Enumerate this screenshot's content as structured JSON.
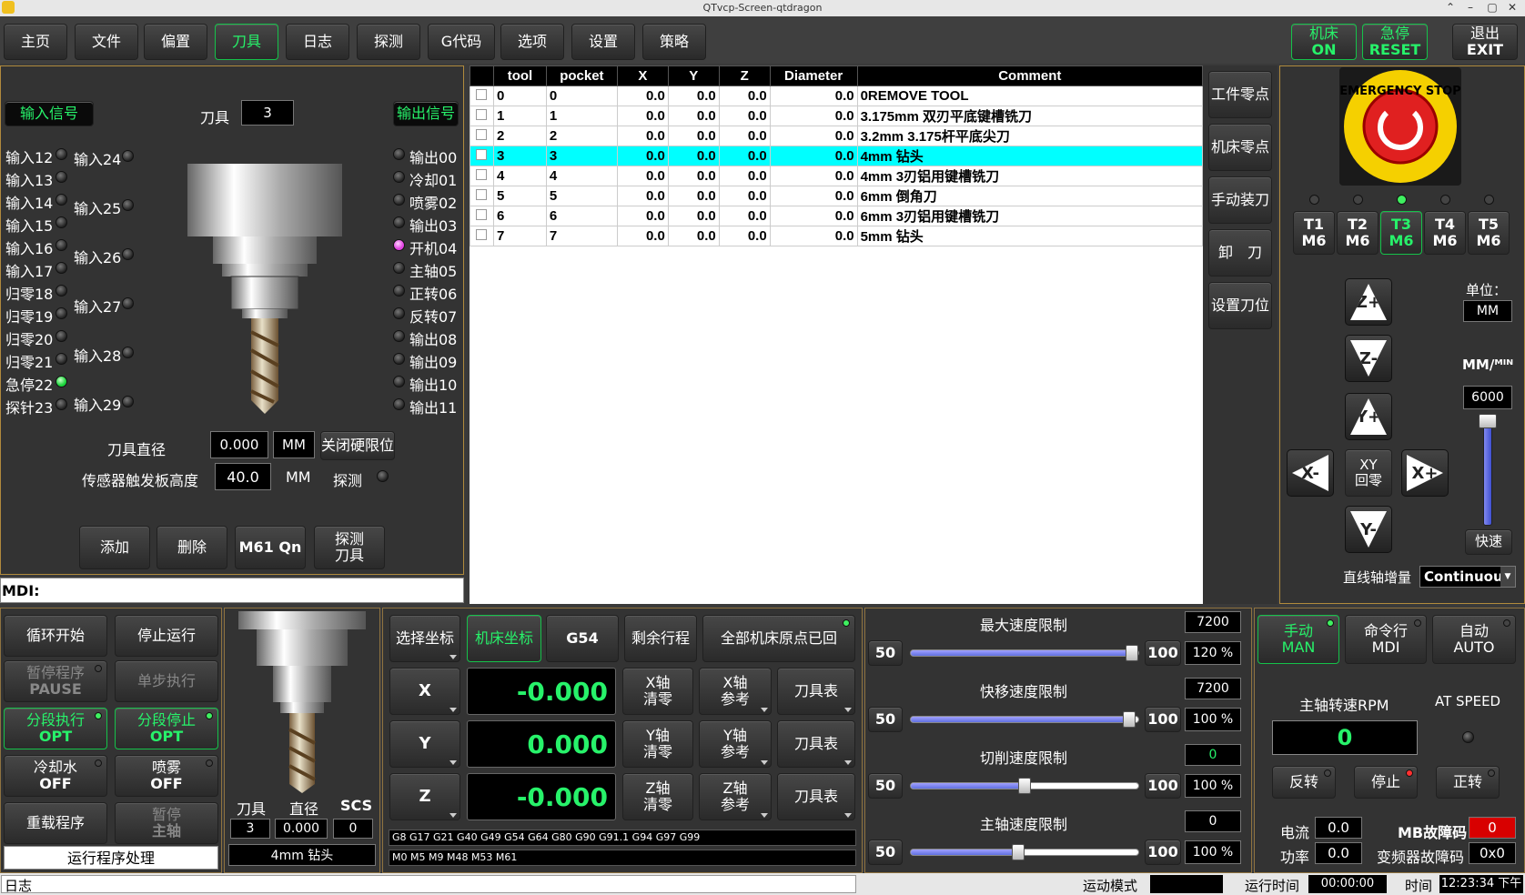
{
  "window": {
    "title": "QTvcp-Screen-qtdragon",
    "min": "–",
    "max": "▢",
    "close": "✕",
    "up": "⌃"
  },
  "tabs": [
    "主页",
    "文件",
    "偏置",
    "刀具",
    "日志",
    "探测",
    "G代码",
    "选项",
    "设置",
    "策略"
  ],
  "active_tab": "刀具",
  "top_right": {
    "machine": [
      "机床",
      "ON"
    ],
    "estop": [
      "急停",
      "RESET"
    ],
    "exit": [
      "退出",
      "EXIT"
    ]
  },
  "io": {
    "input_title": "输入信号",
    "output_title": "输出信号",
    "tool_label": "刀具",
    "tool_value": "3",
    "inputs_left": [
      "输入12",
      "输入13",
      "输入14",
      "输入15",
      "输入16",
      "输入17",
      "归零18",
      "归零19",
      "归零20",
      "归零21",
      "急停22",
      "探针23"
    ],
    "inputs_right": [
      "输入24",
      "输入25",
      "输入26",
      "输入27",
      "输入28",
      "输入29"
    ],
    "outputs": [
      "输出00",
      "冷却01",
      "喷雾02",
      "输出03",
      "开机04",
      "主轴05",
      "正转06",
      "反转07",
      "输出08",
      "输出09",
      "输出10",
      "输出11"
    ],
    "tool_diameter_label": "刀具直径",
    "tool_diameter": "0.000",
    "unit_mm": "MM",
    "close_limit": "关闭硬限位",
    "sensor_label": "传感器触发板高度",
    "sensor_value": "40.0",
    "sensor_unit": "MM",
    "probe_label": "探测",
    "buttons": [
      "添加",
      "删除",
      "M61 Qn",
      "探测\n刀具"
    ]
  },
  "mdi_label": "MDI:",
  "tool_table": {
    "headers": [
      "",
      "tool",
      "pocket",
      "X",
      "Y",
      "Z",
      "Diameter",
      "Comment"
    ],
    "rows": [
      [
        "0",
        "0",
        "0.0",
        "0.0",
        "0.0",
        "0.0",
        "0REMOVE TOOL"
      ],
      [
        "1",
        "1",
        "0.0",
        "0.0",
        "0.0",
        "0.0",
        "3.175mm 双刃平底键槽铣刀"
      ],
      [
        "2",
        "2",
        "0.0",
        "0.0",
        "0.0",
        "0.0",
        "3.2mm 3.175杆平底尖刀"
      ],
      [
        "3",
        "3",
        "0.0",
        "0.0",
        "0.0",
        "0.0",
        "4mm 钻头"
      ],
      [
        "4",
        "4",
        "0.0",
        "0.0",
        "0.0",
        "0.0",
        "4mm 3刃铝用键槽铣刀"
      ],
      [
        "5",
        "5",
        "0.0",
        "0.0",
        "0.0",
        "0.0",
        "6mm 倒角刀"
      ],
      [
        "6",
        "6",
        "0.0",
        "0.0",
        "0.0",
        "0.0",
        "6mm 3刃铝用键槽铣刀"
      ],
      [
        "7",
        "7",
        "0.0",
        "0.0",
        "0.0",
        "0.0",
        "5mm 钻头"
      ]
    ],
    "selected": 3
  },
  "side_buttons": [
    "工件零点",
    "机床零点",
    "手动装刀",
    "卸　刀",
    "设置刀位"
  ],
  "estop_text": "EMERGENCY STOP",
  "tool_changers": [
    [
      "T1",
      "M6"
    ],
    [
      "T2",
      "M6"
    ],
    [
      "T3",
      "M6"
    ],
    [
      "T4",
      "M6"
    ],
    [
      "T5",
      "M6"
    ]
  ],
  "jog": {
    "zplus": "Z+",
    "zminus": "Z-",
    "yplus": "Y+",
    "yminus": "Y-",
    "xminus": "X-",
    "xplus": "X+",
    "xy_home": [
      "XY",
      "回零"
    ],
    "unit_label": "单位：",
    "unit": "MM",
    "rate_label": "MM/ᴹᴵᴺ",
    "rate": "6000",
    "rapid": "快速",
    "increment_label": "直线轴增量",
    "increment": "Continuous"
  },
  "program": {
    "cycle_start": "循环开始",
    "stop": "停止运行",
    "pause": [
      "暂停程序",
      "PAUSE"
    ],
    "step": "单步执行",
    "opt_run": [
      "分段执行",
      "OPT"
    ],
    "opt_stop": [
      "分段停止",
      "OPT"
    ],
    "coolant": [
      "冷却水",
      "OFF"
    ],
    "mist": [
      "喷雾",
      "OFF"
    ],
    "reload": "重载程序",
    "pause_spindle": [
      "暂停",
      "主轴"
    ],
    "status": "运行程序处理"
  },
  "tool_info": {
    "tool_label": "刀具",
    "dia_label": "直径",
    "scs_label": "SCS",
    "tool": "3",
    "dia": "0.000",
    "scs": "0",
    "desc": "4mm 钻头"
  },
  "dro": {
    "select_coord": "选择坐标",
    "machine_coord": "机床坐标",
    "g54": "G54",
    "remaining": "剩余行程",
    "home_all": "全部机床原点已回",
    "axes": [
      {
        "name": "X",
        "value": "-0.000",
        "zero": [
          "X轴",
          "清零"
        ],
        "ref": [
          "X轴",
          "参考"
        ],
        "table": "刀具表"
      },
      {
        "name": "Y",
        "value": "0.000",
        "zero": [
          "Y轴",
          "清零"
        ],
        "ref": [
          "Y轴",
          "参考"
        ],
        "table": "刀具表"
      },
      {
        "name": "Z",
        "value": "-0.000",
        "zero": [
          "Z轴",
          "清零"
        ],
        "ref": [
          "Z轴",
          "参考"
        ],
        "table": "刀具表"
      }
    ],
    "gcodes": "G8 G17 G21 G40 G49 G54 G64 G80 G90 G91.1 G94 G97 G99",
    "mcodes": "M0 M5 M9 M48 M53 M61"
  },
  "limits": [
    {
      "label": "最大速度限制",
      "value": "7200",
      "min": "50",
      "max": "100",
      "pct": "120 %",
      "level": 0.97
    },
    {
      "label": "快移速度限制",
      "value": "7200",
      "min": "50",
      "max": "100",
      "pct": "100 %",
      "level": 0.96
    },
    {
      "label": "切削速度限制",
      "value": "0",
      "min": "50",
      "max": "100",
      "pct": "100 %",
      "level": 0.5
    },
    {
      "label": "主轴速度限制",
      "value": "0",
      "min": "50",
      "max": "100",
      "pct": "100 %",
      "level": 0.47
    }
  ],
  "modes": {
    "man": [
      "手动",
      "MAN"
    ],
    "mdi": [
      "命令行",
      "MDI"
    ],
    "auto": [
      "自动",
      "AUTO"
    ]
  },
  "spindle": {
    "rpm_label": "主轴转速RPM",
    "at_speed": "AT SPEED",
    "rpm": "0",
    "rev": "反转",
    "stop": "停止",
    "fwd": "正转",
    "current_label": "电流",
    "current": "0.0",
    "mb_label": "MB故障码",
    "mb": "0",
    "power_label": "功率",
    "power": "0.0",
    "vfd_label": "变频器故障码",
    "vfd": "0x0"
  },
  "status": {
    "log": "日志",
    "motion_label": "运动模式",
    "runtime_label": "运行时间",
    "runtime": "00:00:00",
    "time_label": "时间",
    "time": "12:23:34 下午"
  }
}
